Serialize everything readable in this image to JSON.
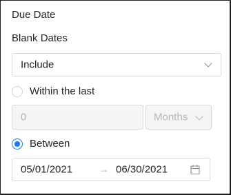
{
  "due_date": {
    "title": "Due Date"
  },
  "blank_dates": {
    "label": "Blank Dates",
    "selected": "Include"
  },
  "within_last": {
    "label": "Within the last",
    "selected": false,
    "amount_value": "0",
    "unit_value": "Months",
    "disabled": true
  },
  "between": {
    "label": "Between",
    "selected": true,
    "start_date": "05/01/2021",
    "separator": "→",
    "end_date": "06/30/2021"
  },
  "colors": {
    "accent": "#1677ff",
    "border": "#d9d9d9",
    "disabled_bg": "#f5f5f5",
    "disabled_text": "#b3b3b3"
  },
  "icons": [
    "chevron-down-icon",
    "arrow-right-icon",
    "calendar-icon"
  ]
}
